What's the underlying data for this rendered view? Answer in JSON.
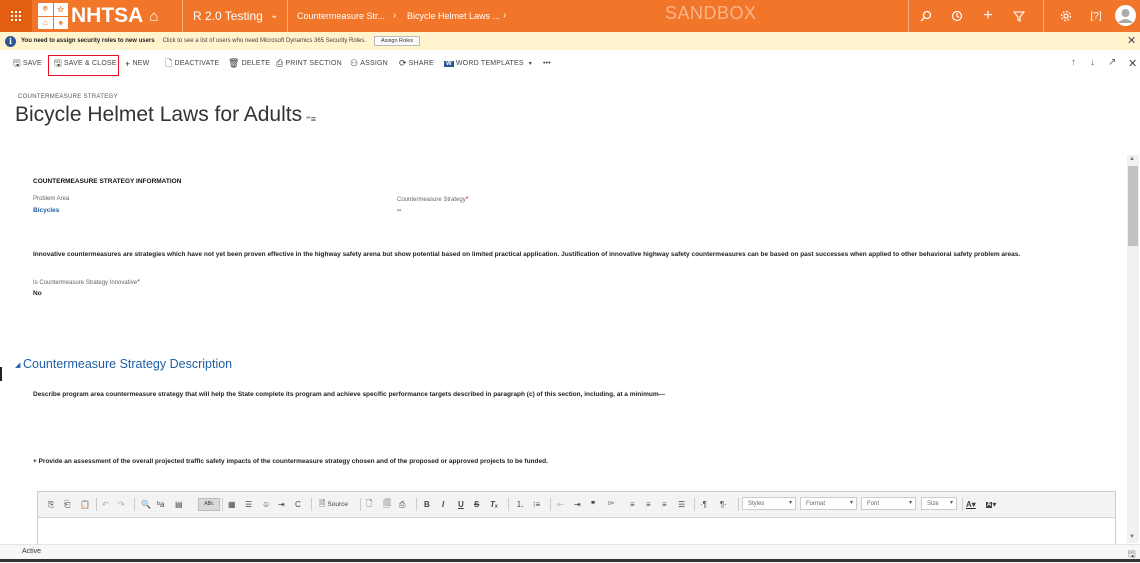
{
  "topnav": {
    "logo_tiles": [
      "⌾",
      "☆",
      "⌂",
      "♠"
    ],
    "logo_text": "NHTSA",
    "app_name": "R 2.0 Testing",
    "breadcrumbs": [
      "Countermeasure Str...",
      "Bicycle Helmet Laws ..."
    ],
    "environment": "SANDBOX",
    "accent_color": "#f27629",
    "icons": [
      "app-launcher-icon",
      "home-icon",
      "search-icon",
      "recent-icon",
      "plus-icon",
      "filter-icon",
      "settings-icon",
      "help-icon",
      "user-avatar-icon"
    ]
  },
  "notification": {
    "message": "You need to assign security roles to new users",
    "detail": "Click to see a list of users who need Microsoft Dynamics 365 Security Roles.",
    "button": "Assign Roles"
  },
  "commands": {
    "save": "SAVE",
    "save_close": "SAVE & CLOSE",
    "new": "NEW",
    "deactivate": "DEACTIVATE",
    "delete": "DELETE",
    "print_section": "PRINT SECTION",
    "assign": "ASSIGN",
    "share": "SHARE",
    "word_templates": "WORD TEMPLATES",
    "more": "•••"
  },
  "header": {
    "entity_type": "COUNTERMEASURE STRATEGY",
    "title": "Bicycle Helmet Laws for Adults"
  },
  "section_info": {
    "title": "COUNTERMEASURE STRATEGY INFORMATION",
    "problem_area_label": "Problem Area",
    "problem_area_value": "Bicycles",
    "strategy_label": "Countermeasure Strategy",
    "strategy_required": "*",
    "strategy_value": "--",
    "innovative_text": "Innovative countermeasures are strategies which have not yet been proven effective in the highway safety arena but show potential based on limited practical application. Justification of innovative highway safety countermeasures can be based on past successes when applied to other behavioral safety problem areas.",
    "innovative_label": "Is Countermeasure Strategy Innovative",
    "innovative_required": "*",
    "innovative_value": "No"
  },
  "section_description": {
    "title": "Countermeasure Strategy Description",
    "describe_text": "Describe program area countermeasure strategy that will help the State complete its program and achieve specific performance targets described in paragraph (c) of this section, including, at a minimum—",
    "provide_text": "+ Provide an assessment of the overall projected traffic safety impacts of the countermeasure strategy chosen and of the proposed or approved projects to be funded."
  },
  "editor": {
    "source_label": "Source",
    "styles": "Styles",
    "format": "Format",
    "font": "Font",
    "size": "Size"
  },
  "footer": {
    "status": "Active"
  }
}
